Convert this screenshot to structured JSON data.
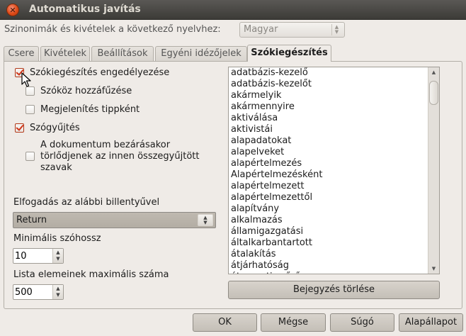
{
  "window": {
    "title": "Automatikus javítás"
  },
  "language": {
    "label": "Szinonimák és kivételek a következő nyelvhez:",
    "selected": "Magyar"
  },
  "tabs": [
    {
      "label": "Csere"
    },
    {
      "label": "Kivételek"
    },
    {
      "label": "Beállítások"
    },
    {
      "label": "Egyéni idézőjelek"
    },
    {
      "label": "Szókiegészítés"
    }
  ],
  "options": {
    "enable": {
      "label": "Szókiegészítés engedélyezése",
      "checked": true
    },
    "append_space": {
      "label": "Szóköz hozzáfűzése",
      "checked": false
    },
    "show_tip": {
      "label": "Megjelenítés tippként",
      "checked": false
    },
    "collect": {
      "label": "Szógyűjtés",
      "checked": true
    },
    "remove_on_close": {
      "label_line1": "A dokumentum bezárásakor",
      "label_line2": "törlődjenek az innen összegyűjtött",
      "label_line3": "szavak",
      "checked": false
    }
  },
  "accept_key": {
    "label": "Elfogadás az alábbi billentyűvel",
    "selected": "Return"
  },
  "min_word_length": {
    "label": "Minimális szóhossz",
    "value": "10"
  },
  "max_entries": {
    "label": "Lista elemeinek maximális száma",
    "value": "500"
  },
  "words": [
    "adatbázis-kezelő",
    "adatbázis-kezelőt",
    "akármelyik",
    "akármennyire",
    "aktiválása",
    "aktivistái",
    "alapadatokat",
    "alapelveket",
    "alapértelmezés",
    "Alapértelmezésként",
    "alapértelmezett",
    "alapértelmezettől",
    "alapítvány",
    "alkalmazás",
    "államigazgatási",
    "általkarbantartott",
    "átalakítás",
    "átjárhatóság",
    "átmeneti szűrő"
  ],
  "delete_entry": {
    "label": "Bejegyzés törlése"
  },
  "buttons": {
    "ok": "OK",
    "cancel": "Mégse",
    "help": "Súgó",
    "reset": "Alapállapot"
  }
}
